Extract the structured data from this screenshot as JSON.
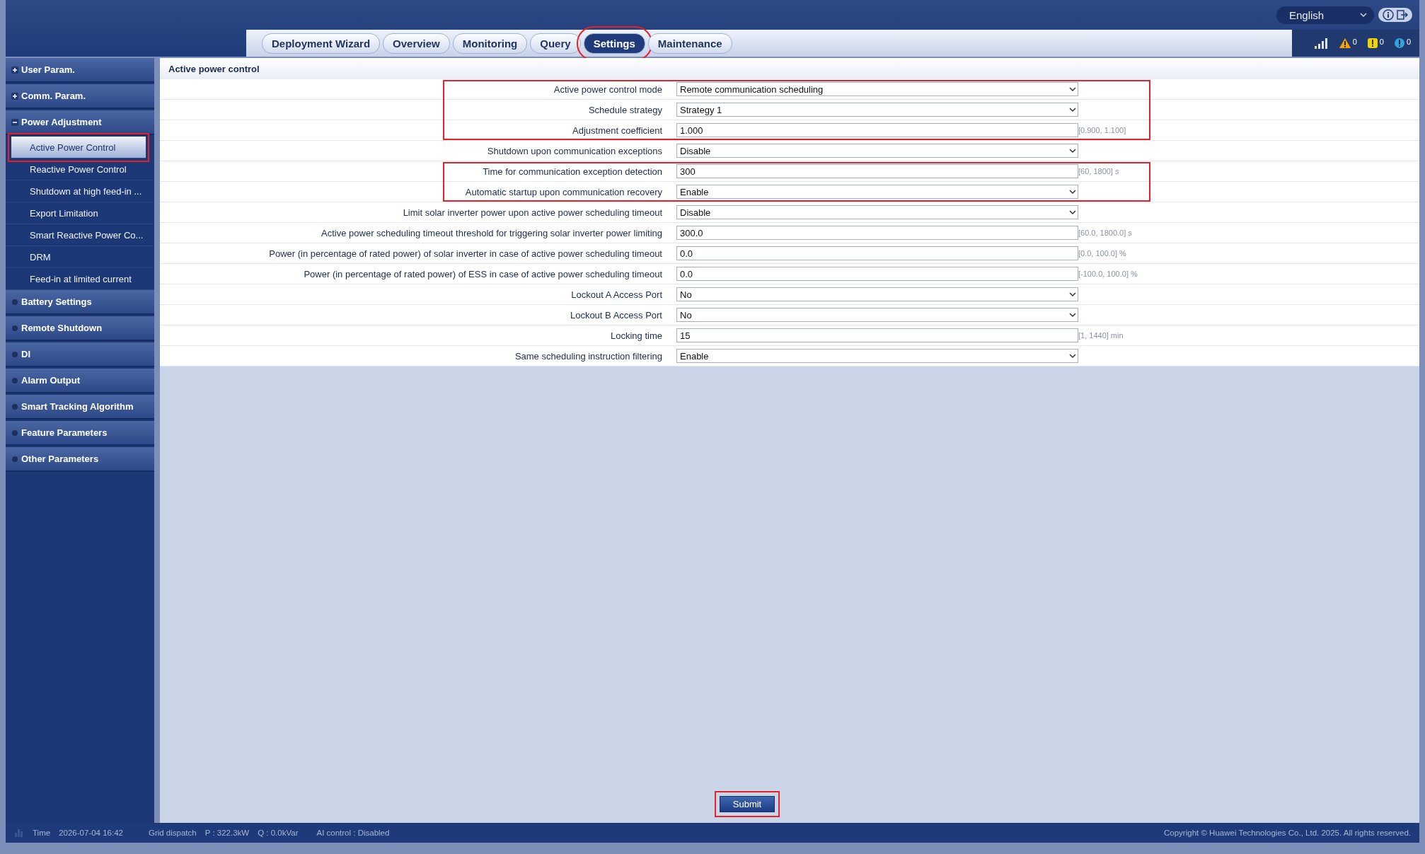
{
  "header": {
    "language": "English",
    "tabs": [
      {
        "label": "Deployment Wizard",
        "selected": false,
        "highlighted": false
      },
      {
        "label": "Overview",
        "selected": false,
        "highlighted": false
      },
      {
        "label": "Monitoring",
        "selected": false,
        "highlighted": false
      },
      {
        "label": "Query",
        "selected": false,
        "highlighted": false
      },
      {
        "label": "Settings",
        "selected": true,
        "highlighted": true
      },
      {
        "label": "Maintenance",
        "selected": false,
        "highlighted": false
      }
    ],
    "alarms": [
      {
        "kind": "major",
        "count": "0"
      },
      {
        "kind": "minor",
        "count": "0"
      },
      {
        "kind": "warning",
        "count": "0"
      }
    ]
  },
  "sidebar": {
    "items": [
      {
        "label": "User Param.",
        "kind": "collapsed"
      },
      {
        "label": "Comm. Param.",
        "kind": "collapsed"
      },
      {
        "label": "Power Adjustment",
        "kind": "expanded",
        "children": [
          {
            "label": "Active Power Control",
            "selected": true,
            "highlighted": true
          },
          {
            "label": "Reactive Power Control",
            "selected": false,
            "highlighted": false
          },
          {
            "label": "Shutdown at high feed-in ...",
            "selected": false,
            "highlighted": false
          },
          {
            "label": "Export Limitation",
            "selected": false,
            "highlighted": false
          },
          {
            "label": "Smart Reactive Power Co...",
            "selected": false,
            "highlighted": false
          },
          {
            "label": "DRM",
            "selected": false,
            "highlighted": false
          },
          {
            "label": "Feed-in at limited current",
            "selected": false,
            "highlighted": false
          }
        ]
      },
      {
        "label": "Battery Settings",
        "kind": "leaf"
      },
      {
        "label": "Remote Shutdown",
        "kind": "leaf"
      },
      {
        "label": "DI",
        "kind": "leaf"
      },
      {
        "label": "Alarm Output",
        "kind": "leaf"
      },
      {
        "label": "Smart Tracking Algorithm",
        "kind": "leaf"
      },
      {
        "label": "Feature Parameters",
        "kind": "leaf"
      },
      {
        "label": "Other Parameters",
        "kind": "leaf"
      }
    ]
  },
  "panel": {
    "title": "Active power control",
    "fields": [
      {
        "label": "Active power control mode",
        "kind": "select",
        "value": "Remote communication scheduling",
        "highlighted": true
      },
      {
        "label": "Schedule strategy",
        "kind": "select",
        "value": "Strategy 1",
        "highlighted": true
      },
      {
        "label": "Adjustment coefficient",
        "kind": "input",
        "value": "1.000",
        "range": "[0.900, 1.100]",
        "highlighted": true
      },
      {
        "label": "Shutdown upon communication exceptions",
        "kind": "select",
        "value": "Disable",
        "highlighted": false
      },
      {
        "label": "Time for communication exception detection",
        "kind": "input",
        "value": "300",
        "range": "[60, 1800] s",
        "highlighted": true
      },
      {
        "label": "Automatic startup upon communication recovery",
        "kind": "select",
        "value": "Enable",
        "highlighted": true
      },
      {
        "label": "Limit solar inverter power upon active power scheduling timeout",
        "kind": "select",
        "value": "Disable",
        "highlighted": false
      },
      {
        "label": "Active power scheduling timeout threshold for triggering solar inverter power limiting",
        "kind": "input",
        "value": "300.0",
        "range": "[60.0, 1800.0] s",
        "highlighted": false
      },
      {
        "label": "Power (in percentage of rated power) of solar inverter in case of active power scheduling timeout",
        "kind": "input",
        "value": "0.0",
        "range": "[0.0, 100.0] %",
        "highlighted": false
      },
      {
        "label": "Power (in percentage of rated power) of ESS in case of active power scheduling timeout",
        "kind": "input",
        "value": "0.0",
        "range": "[-100.0, 100.0] %",
        "highlighted": false
      },
      {
        "label": "Lockout A Access Port",
        "kind": "select",
        "value": "No",
        "highlighted": false
      },
      {
        "label": "Lockout B Access Port",
        "kind": "select",
        "value": "No",
        "highlighted": false
      },
      {
        "label": "Locking time",
        "kind": "input",
        "value": "15",
        "range": "[1, 1440] min",
        "highlighted": false
      },
      {
        "label": "Same scheduling instruction filtering",
        "kind": "select",
        "value": "Enable",
        "highlighted": false
      }
    ],
    "submit": {
      "label": "Submit",
      "highlighted": true
    }
  },
  "status_bar": {
    "time_label": "Time",
    "time": "2026-07-04 16:42",
    "items": [
      "Grid dispatch",
      "P : 322.3kW",
      "Q : 0.0kVar",
      "AI control : Disabled"
    ],
    "copyright": "Copyright © Huawei Technologies Co., Ltd. 2025. All rights reserved."
  }
}
